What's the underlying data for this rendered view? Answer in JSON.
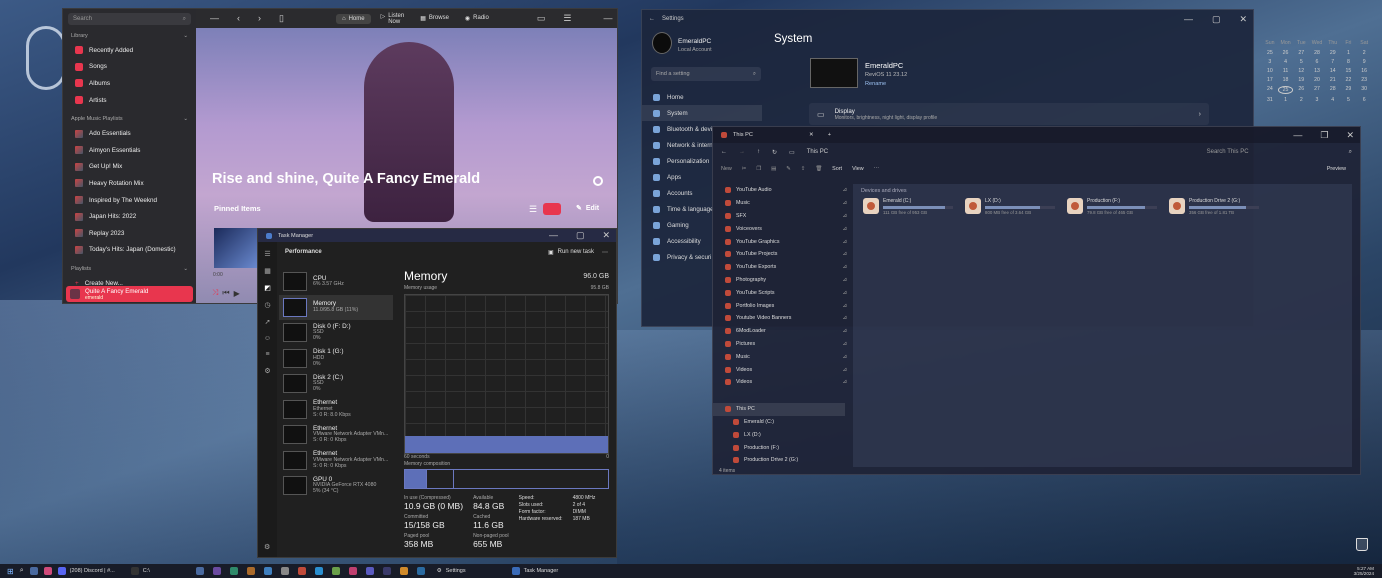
{
  "music": {
    "search_placeholder": "Search",
    "library_heading": "Library",
    "library_items": [
      "Recently Added",
      "Songs",
      "Albums",
      "Artists"
    ],
    "playlists_heading": "Apple Music Playlists",
    "playlist_items": [
      "Ado Essentials",
      "Aimyon Essentials",
      "Get Up! Mix",
      "Heavy Rotation Mix",
      "Inspired by The Weeknd",
      "Japan Hits: 2022",
      "Replay 2023",
      "Today's Hits: Japan (Domestic)"
    ],
    "user_playlists_heading": "Playlists",
    "create_new": "Create New...",
    "now_playing_title": "Quite A Fancy Emerald",
    "now_playing_sub": "emerald",
    "tabs": [
      "Home",
      "Listen Now",
      "Browse",
      "Radio"
    ],
    "greeting": "Rise and shine, Quite A Fancy Emerald",
    "pinned": "Pinned Items",
    "edit": "Edit",
    "time": "0:00"
  },
  "tm": {
    "title": "Task Manager",
    "section": "Performance",
    "run_task": "Run new task",
    "items": [
      {
        "t": "CPU",
        "s1": "6% 3.57 GHz",
        "s2": ""
      },
      {
        "t": "Memory",
        "s1": "11.0/95.8 GB (11%)",
        "s2": ""
      },
      {
        "t": "Disk 0 (F: D:)",
        "s1": "SSD",
        "s2": "0%"
      },
      {
        "t": "Disk 1 (G:)",
        "s1": "HDD",
        "s2": "0%"
      },
      {
        "t": "Disk 2 (C:)",
        "s1": "SSD",
        "s2": "0%"
      },
      {
        "t": "Ethernet",
        "s1": "Ethernet",
        "s2": "S: 0 R: 8.0 Kbps"
      },
      {
        "t": "Ethernet",
        "s1": "VMware Network Adapter VMn...",
        "s2": "S: 0 R: 0 Kbps"
      },
      {
        "t": "Ethernet",
        "s1": "VMware Network Adapter VMn...",
        "s2": "S: 0 R: 0 Kbps"
      },
      {
        "t": "GPU 0",
        "s1": "NVIDIA GeForce RTX 4080",
        "s2": "5% (34 °C)"
      }
    ],
    "mem_title": "Memory",
    "mem_total": "96.0 GB",
    "mem_usage_label": "Memory usage",
    "mem_usage_max": "95.8 GB",
    "seconds": "60 seconds",
    "zero": "0",
    "composition": "Memory composition",
    "in_use_l": "In use (Compressed)",
    "in_use_v": "10.9 GB (0 MB)",
    "avail_l": "Available",
    "avail_v": "84.8 GB",
    "commit_l": "Committed",
    "commit_v": "15/158 GB",
    "cached_l": "Cached",
    "cached_v": "11.6 GB",
    "paged_l": "Paged pool",
    "paged_v": "358 MB",
    "nonpaged_l": "Non-paged pool",
    "nonpaged_v": "655 MB",
    "speed_l": "Speed:",
    "speed_v": "4800 MHz",
    "slots_l": "Slots used:",
    "slots_v": "2 of 4",
    "form_l": "Form factor:",
    "form_v": "DIMM",
    "hwres_l": "Hardware reserved:",
    "hwres_v": "187 MB",
    "usage_fraction": 0.11
  },
  "settings": {
    "title": "Settings",
    "user": "EmeraldPC",
    "account": "Local Account",
    "find": "Find a setting",
    "nav": [
      "Home",
      "System",
      "Bluetooth & devi",
      "Network & intern",
      "Personalization",
      "Apps",
      "Accounts",
      "Time & language",
      "Gaming",
      "Accessibility",
      "Privacy & securi"
    ],
    "heading": "System",
    "pc": "EmeraldPC",
    "os": "ReviOS 11 23.12",
    "rename": "Rename",
    "display": "Display",
    "display_sub": "Monitors, brightness, night light, display profile"
  },
  "explorer": {
    "tab": "This PC",
    "crumb": "This PC",
    "search": "Search This PC",
    "new": "New",
    "sort": "Sort",
    "view": "View",
    "preview": "Preview",
    "pins": [
      "YouTube Audio",
      "Music",
      "SFX",
      "Voiceovers",
      "YouTube Graphics",
      "YouTube Projects",
      "YouTube Exports",
      "Photography",
      "YouTube Scripts",
      "Portfolio Images",
      "Youtube Video Banners",
      "6ModLoader",
      "Pictures",
      "Music",
      "Videos",
      "Videos"
    ],
    "tree_root": "This PC",
    "tree": [
      "Emerald (C:)",
      "LX (D:)",
      "Production (F:)",
      "Production Drive 2 (G:)"
    ],
    "group": "Devices and drives",
    "drives": [
      {
        "name": "Emerald (C:)",
        "free": "111 GB free of 953 GB",
        "used": 0.88
      },
      {
        "name": "LX (D:)",
        "free": "800 MB free of 3.64 GB",
        "used": 0.78
      },
      {
        "name": "Production (F:)",
        "free": "79.8 GB free of 465 GB",
        "used": 0.83
      },
      {
        "name": "Production Drive 2 (G:)",
        "free": "356 GB free of 1.81 TB",
        "used": 0.81
      }
    ],
    "status": "4 items"
  },
  "calendar": {
    "days": [
      "Sun",
      "Mon",
      "Tue",
      "Wed",
      "Thu",
      "Fri",
      "Sat"
    ],
    "dates": [
      "25",
      "26",
      "27",
      "28",
      "29",
      "1",
      "2",
      "3",
      "4",
      "5",
      "6",
      "7",
      "8",
      "9",
      "10",
      "11",
      "12",
      "13",
      "14",
      "15",
      "16",
      "17",
      "18",
      "19",
      "20",
      "21",
      "22",
      "23",
      "24",
      "25",
      "26",
      "27",
      "28",
      "29",
      "30",
      "31",
      "1",
      "2",
      "3",
      "4",
      "5",
      "6"
    ]
  },
  "taskbar": {
    "discord": "(208) Discord | #...",
    "cdrive": "C:\\",
    "settings": "Settings",
    "taskmgr": "Task Manager",
    "time": "5:27 AM",
    "date": "3/25/2024"
  }
}
